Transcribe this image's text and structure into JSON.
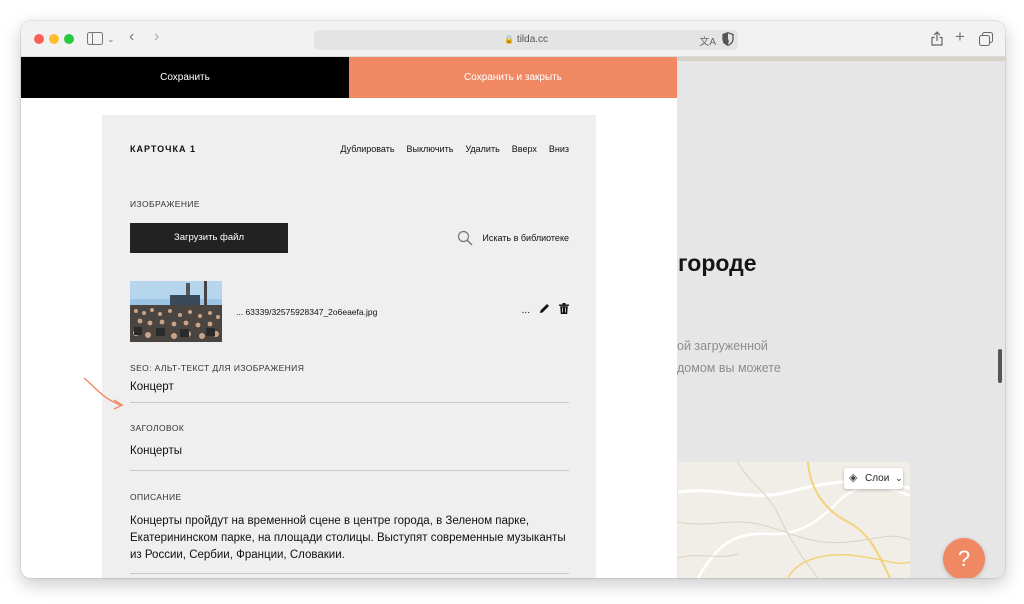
{
  "browser": {
    "url": "tilda.cc"
  },
  "editor": {
    "save_label": "Сохранить",
    "save_close_label": "Сохранить и закрыть",
    "card": {
      "title": "КАРТОЧКА 1",
      "actions": [
        "Дублировать",
        "Выключить",
        "Удалить",
        "Вверх",
        "Вниз"
      ],
      "image_label": "ИЗОБРАЖЕНИЕ",
      "upload_label": "Загрузить файл",
      "library_search_label": "Искать в библиотеке",
      "file_name": "... 63339/32575928347_2o6eaefa.jpg",
      "file_more": "...",
      "seo_label": "SEO: АЛЬТ-ТЕКСТ ДЛЯ ИЗОБРАЖЕНИЯ",
      "seo_value": "Концерт",
      "heading_label": "ЗАГОЛОВОК",
      "heading_value": "Концерты",
      "description_label": "ОПИСАНИЕ",
      "description_value": "Концерты пройдут на временной сцене в центре города, в Зеленом парке, Екатерининском парке, на площади столицы. Выступят современные музыканты из России, Сербии, Франции, Словакии."
    }
  },
  "site": {
    "heading_fragment": "городе",
    "text_line_1": "ой загруженной",
    "text_line_2": "домом вы можете",
    "map_layers_label": "Слои",
    "help_label": "?"
  },
  "colors": {
    "accent": "#f08963",
    "dark": "#000000",
    "card_bg": "#efefef"
  }
}
